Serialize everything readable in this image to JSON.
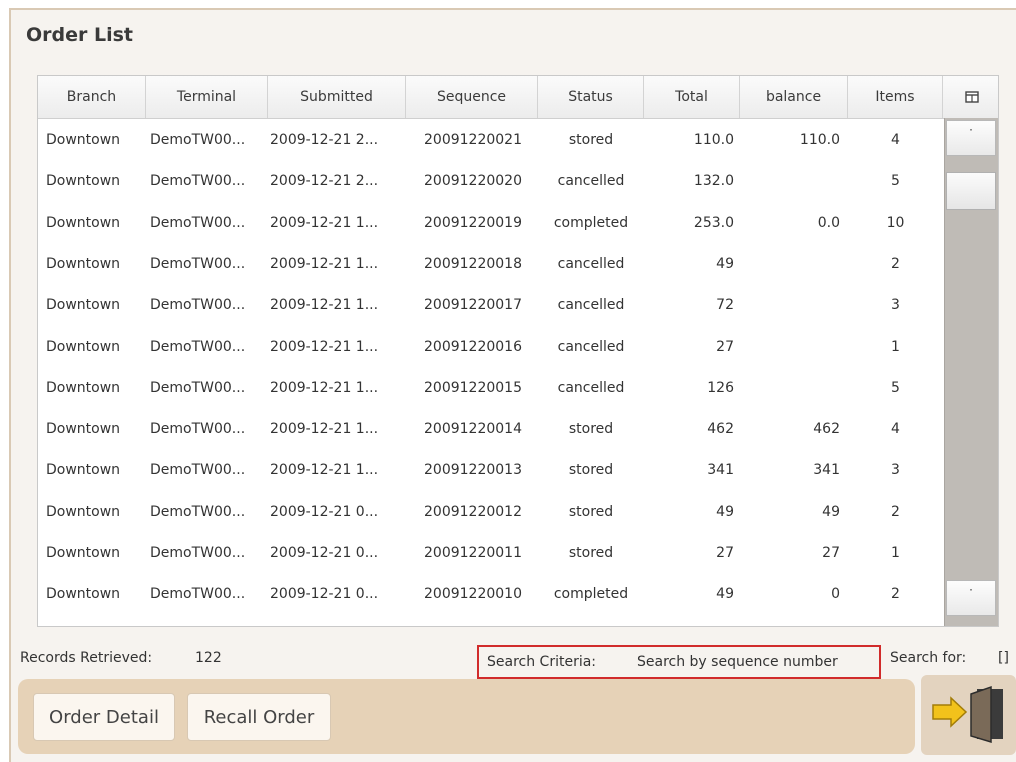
{
  "window": {
    "title": "Order List"
  },
  "table": {
    "columns": [
      "Branch",
      "Terminal",
      "Submitted",
      "Sequence",
      "Status",
      "Total",
      "balance",
      "Items"
    ],
    "rows": [
      [
        "Downtown",
        "DemoTW00...",
        "2009-12-21 2...",
        "20091220021",
        "stored",
        "110.0",
        "110.0",
        "4"
      ],
      [
        "Downtown",
        "DemoTW00...",
        "2009-12-21 2...",
        "20091220020",
        "cancelled",
        "132.0",
        "",
        "5"
      ],
      [
        "Downtown",
        "DemoTW00...",
        "2009-12-21 1...",
        "20091220019",
        "completed",
        "253.0",
        "0.0",
        "10"
      ],
      [
        "Downtown",
        "DemoTW00...",
        "2009-12-21 1...",
        "20091220018",
        "cancelled",
        "49",
        "",
        "2"
      ],
      [
        "Downtown",
        "DemoTW00...",
        "2009-12-21 1...",
        "20091220017",
        "cancelled",
        "72",
        "",
        "3"
      ],
      [
        "Downtown",
        "DemoTW00...",
        "2009-12-21 1...",
        "20091220016",
        "cancelled",
        "27",
        "",
        "1"
      ],
      [
        "Downtown",
        "DemoTW00...",
        "2009-12-21 1...",
        "20091220015",
        "cancelled",
        "126",
        "",
        "5"
      ],
      [
        "Downtown",
        "DemoTW00...",
        "2009-12-21 1...",
        "20091220014",
        "stored",
        "462",
        "462",
        "4"
      ],
      [
        "Downtown",
        "DemoTW00...",
        "2009-12-21 1...",
        "20091220013",
        "stored",
        "341",
        "341",
        "3"
      ],
      [
        "Downtown",
        "DemoTW00...",
        "2009-12-21 0...",
        "20091220012",
        "stored",
        "49",
        "49",
        "2"
      ],
      [
        "Downtown",
        "DemoTW00...",
        "2009-12-21 0...",
        "20091220011",
        "stored",
        "27",
        "27",
        "1"
      ],
      [
        "Downtown",
        "DemoTW00...",
        "2009-12-21 0...",
        "20091220010",
        "completed",
        "49",
        "0",
        "2"
      ]
    ],
    "column_picker_icon": "column-picker-icon"
  },
  "status": {
    "records_label": "Records Retrieved:",
    "records_count": "122",
    "criteria_label": "Search Criteria:",
    "criteria_value": "Search by sequence number",
    "search_for_label": "Search for:",
    "search_for_value": "[]"
  },
  "actions": {
    "order_detail": "Order Detail",
    "recall_order": "Recall Order"
  },
  "colors": {
    "action_bar": "#e6d2b7",
    "highlight_border": "#d12b2b"
  }
}
